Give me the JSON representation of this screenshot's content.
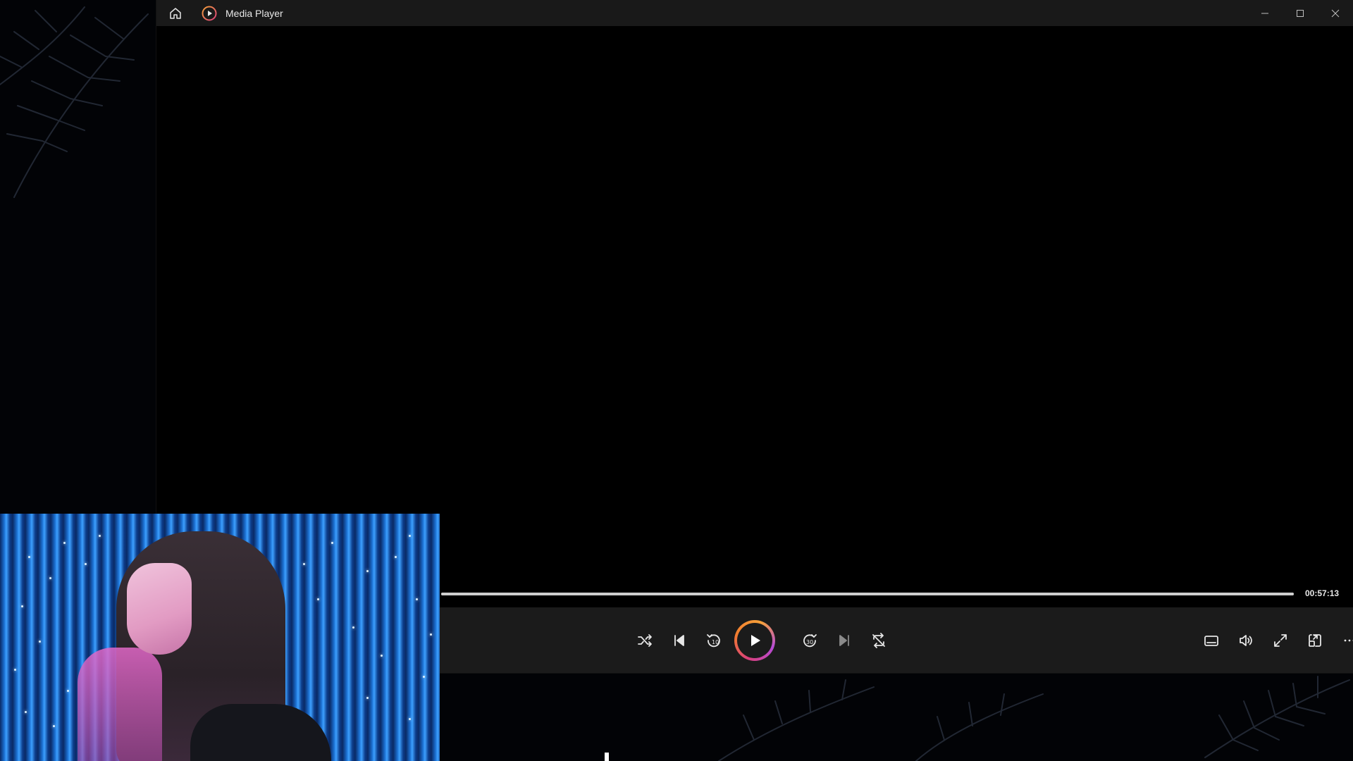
{
  "window": {
    "title": "Media Player"
  },
  "playback": {
    "elapsed_time": "00:57:13",
    "progress_fraction": 1.0,
    "state": "paused"
  },
  "controls": {
    "shuffle": "shuffle-icon",
    "previous": "previous-icon",
    "skip_back": "skip-back-10-icon",
    "play": "play-icon",
    "skip_forward": "skip-forward-30-icon",
    "next": "next-icon",
    "repeat": "repeat-off-icon",
    "captions": "captions-icon",
    "volume": "volume-icon",
    "fullscreen": "fullscreen-icon",
    "mini_player": "mini-player-icon",
    "more": "more-icon"
  },
  "colors": {
    "play_ring_start": "#d9407a",
    "play_ring_end": "#f6a13a",
    "titlebar_bg": "#191919",
    "controlbar_bg": "#1b1b1b"
  }
}
